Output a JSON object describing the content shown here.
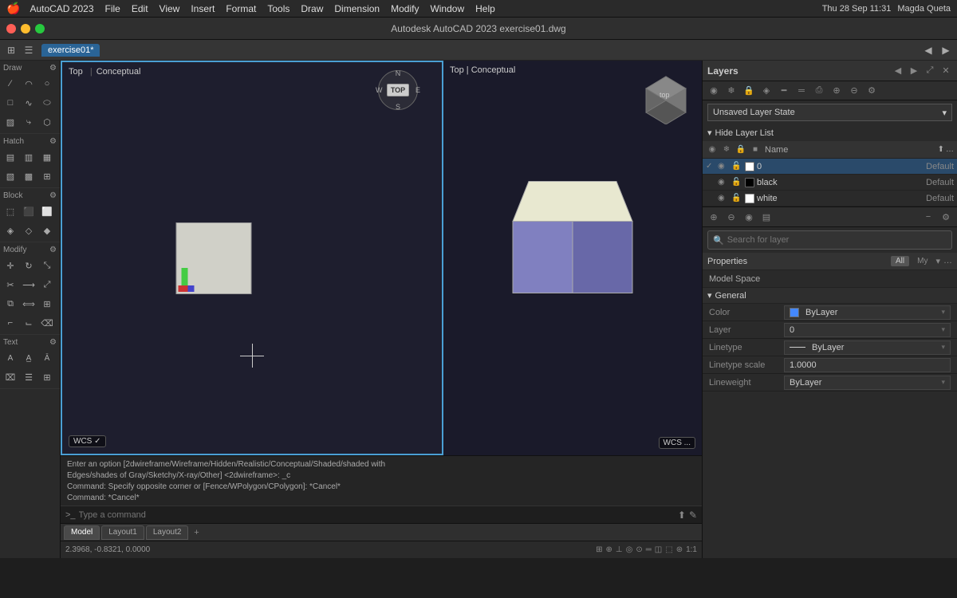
{
  "menubar": {
    "apple": "⌘",
    "app_name": "AutoCAD 2023",
    "menus": [
      "File",
      "Edit",
      "View",
      "Insert",
      "Format",
      "Tools",
      "Draw",
      "Dimension",
      "Modify",
      "Window",
      "Help"
    ],
    "right": "Thu 28 Sep  11:31",
    "user": "Magda Queta"
  },
  "titlebar": {
    "title": "Autodesk AutoCAD 2023   exercise01.dwg"
  },
  "toolbar2": {
    "active_tab": "exercise01*"
  },
  "viewport_left": {
    "label1": "Top",
    "label2": "Conceptual",
    "wcs": "WCS ✓"
  },
  "viewport_right": {
    "wcs": "WCS ..."
  },
  "cmdline": {
    "line1": "Enter an option [2dwireframe/Wireframe/Hidden/Realistic/Conceptual/Shaded/shaded with",
    "line2": "Edges/shades of Gray/Sketchy/X-ray/Other] <2dwireframe>: _c",
    "line3": "Command: Specify opposite corner or [Fence/WPolygon/CPolygon]: *Cancel*",
    "line4": "Command: *Cancel*",
    "prompt": ">_",
    "input_placeholder": "Type a command"
  },
  "statusbar": {
    "coords": "2.3968, -0.8321, 0.0000",
    "zoom": "1:1"
  },
  "tabbar": {
    "tabs": [
      {
        "label": "Model",
        "active": true
      },
      {
        "label": "Layout1",
        "active": false
      },
      {
        "label": "Layout2",
        "active": false
      }
    ],
    "add_label": "+"
  },
  "layers_panel": {
    "title": "Layers",
    "layer_state": "Unsaved Layer State",
    "hide_label": "Hide Layer List",
    "columns": {
      "name": "Name"
    },
    "layers": [
      {
        "name": "0",
        "color": "#ffffff",
        "state": "Default",
        "active": true
      },
      {
        "name": "black",
        "color": "#000000",
        "state": "Default",
        "active": false
      },
      {
        "name": "white",
        "color": "#ffffff",
        "state": "Default",
        "active": false
      }
    ],
    "search_placeholder": "Search for layer"
  },
  "properties_panel": {
    "title": "Properties",
    "tabs": [
      "All",
      "My"
    ],
    "space": "Model Space",
    "general_header": "General",
    "properties": [
      {
        "label": "Color",
        "value": "ByLayer",
        "color": "#4488ff"
      },
      {
        "label": "Layer",
        "value": "0"
      },
      {
        "label": "Linetype",
        "value": "ByLayer",
        "has_line": true
      },
      {
        "label": "Linetype scale",
        "value": "1.0000"
      },
      {
        "label": "Lineweight",
        "value": "ByLayer"
      }
    ]
  },
  "icons": {
    "arrow_down": "▾",
    "arrow_right": "▸",
    "close": "✕",
    "eye": "◉",
    "lock": "🔒",
    "search": "🔍",
    "plus": "+",
    "minus": "−",
    "settings": "⚙",
    "layers": "≡",
    "refresh": "↺",
    "expand": "⤢"
  }
}
